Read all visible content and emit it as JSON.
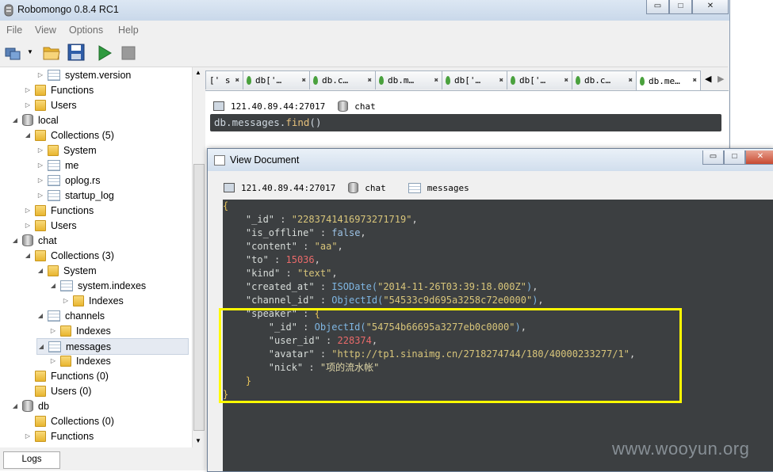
{
  "app": {
    "title": "Robomongo 0.8.4 RC1"
  },
  "window_controls": {
    "minimize": "▭",
    "maximize": "□",
    "close": "✕"
  },
  "menu": [
    "File",
    "View",
    "Options",
    "Help"
  ],
  "toolbar": {
    "icons": [
      "connect-icon",
      "open-folder-icon",
      "save-icon",
      "run-icon",
      "stop-icon"
    ]
  },
  "tree": [
    {
      "label": "system.version",
      "indent": 5,
      "icon": "table",
      "arrow": "▷"
    },
    {
      "label": "Functions",
      "indent": 4,
      "icon": "folder",
      "arrow": "▷"
    },
    {
      "label": "Users",
      "indent": 4,
      "icon": "folder",
      "arrow": "▷"
    },
    {
      "label": "local",
      "indent": 3,
      "icon": "db",
      "arrow": "◢"
    },
    {
      "label": "Collections (5)",
      "indent": 4,
      "icon": "folder",
      "arrow": "◢"
    },
    {
      "label": "System",
      "indent": 5,
      "icon": "folder",
      "arrow": "▷"
    },
    {
      "label": "me",
      "indent": 5,
      "icon": "table",
      "arrow": "▷"
    },
    {
      "label": "oplog.rs",
      "indent": 5,
      "icon": "table",
      "arrow": "▷"
    },
    {
      "label": "startup_log",
      "indent": 5,
      "icon": "table",
      "arrow": "▷"
    },
    {
      "label": "Functions",
      "indent": 4,
      "icon": "folder",
      "arrow": "▷"
    },
    {
      "label": "Users",
      "indent": 4,
      "icon": "folder",
      "arrow": "▷"
    },
    {
      "label": "chat",
      "indent": 3,
      "icon": "db",
      "arrow": "◢"
    },
    {
      "label": "Collections (3)",
      "indent": 4,
      "icon": "folder",
      "arrow": "◢"
    },
    {
      "label": "System",
      "indent": 5,
      "icon": "folder",
      "arrow": "◢"
    },
    {
      "label": "system.indexes",
      "indent": 6,
      "icon": "table",
      "arrow": "◢"
    },
    {
      "label": "Indexes",
      "indent": 7,
      "icon": "folder",
      "arrow": "▷"
    },
    {
      "label": "channels",
      "indent": 5,
      "icon": "table",
      "arrow": "◢"
    },
    {
      "label": "Indexes",
      "indent": 6,
      "icon": "folder",
      "arrow": "▷"
    },
    {
      "label": "messages",
      "indent": 5,
      "icon": "table",
      "arrow": "◢",
      "selected": true
    },
    {
      "label": "Indexes",
      "indent": 6,
      "icon": "folder",
      "arrow": "▷"
    },
    {
      "label": "Functions (0)",
      "indent": 4,
      "icon": "folder",
      "arrow": ""
    },
    {
      "label": "Users (0)",
      "indent": 4,
      "icon": "folder",
      "arrow": ""
    },
    {
      "label": "db",
      "indent": 3,
      "icon": "db",
      "arrow": "◢"
    },
    {
      "label": "Collections (0)",
      "indent": 4,
      "icon": "folder",
      "arrow": ""
    },
    {
      "label": "Functions",
      "indent": 4,
      "icon": "folder",
      "arrow": "▷"
    }
  ],
  "logs_tab": "Logs",
  "tabs": [
    {
      "label": "[' s",
      "leaf": false
    },
    {
      "label": "db['…",
      "leaf": true
    },
    {
      "label": "db.c…",
      "leaf": true
    },
    {
      "label": "db.m…",
      "leaf": true
    },
    {
      "label": "db['…",
      "leaf": true
    },
    {
      "label": "db['…",
      "leaf": true
    },
    {
      "label": "db.c…",
      "leaf": true
    },
    {
      "label": "db.me…",
      "leaf": true,
      "active": true
    }
  ],
  "tab_close": "✖",
  "tab_scroll": {
    "left": "◀",
    "right": "▶"
  },
  "connection": {
    "host": "121.40.89.44:27017",
    "database": "chat"
  },
  "query": {
    "prefix": "db.messages.",
    "method": "find",
    "args": "()"
  },
  "dialog": {
    "title": "View Document",
    "host": "121.40.89.44:27017",
    "database": "chat",
    "collection": "messages"
  },
  "document": {
    "_id": "2283741416973271719",
    "is_offline": "false",
    "content": "aa",
    "to": "15036",
    "kind": "text",
    "created_at": "2014-11-26T03:39:18.000Z",
    "channel_id": "54533c9d695a3258c72e0000",
    "speaker": {
      "_id": "54754b66695a3277eb0c0000",
      "user_id": "228374",
      "avatar": "http://tp1.sinaimg.cn/2718274744/180/40000233277/1",
      "nick": "项的流水帐"
    }
  },
  "watermark": "www.wooyun.org"
}
